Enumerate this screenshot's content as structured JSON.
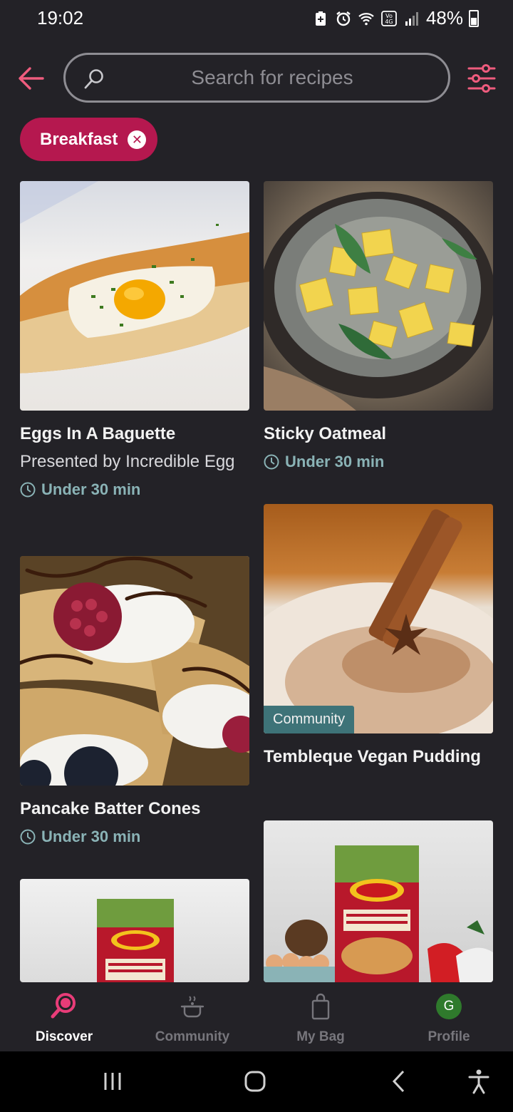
{
  "status_bar": {
    "time": "19:02",
    "battery": "48%",
    "icons": [
      "battery-saver-icon",
      "alarm-icon",
      "wifi-icon",
      "volte-4g-icon",
      "signal-icon",
      "battery-icon"
    ]
  },
  "header": {
    "back_icon": "arrow-left-icon",
    "search_placeholder": "Search for recipes",
    "filter_icon": "sliders-icon"
  },
  "filter_chip": {
    "label": "Breakfast",
    "close_glyph": "✕"
  },
  "recipes": [
    {
      "title": "Eggs In A Baguette",
      "subtitle": "Presented by Incredible Egg",
      "time": "Under 30 min"
    },
    {
      "title": "Sticky Oatmeal",
      "time": "Under 30 min"
    },
    {
      "title": "Tembleque Vegan Pudding",
      "badge": "Community"
    },
    {
      "title": "Pancake Batter Cones",
      "time": "Under 30 min"
    }
  ],
  "bottom_nav": {
    "items": [
      {
        "label": "Discover",
        "icon": "discover-icon",
        "active": true
      },
      {
        "label": "Community",
        "icon": "cooking-pot-icon",
        "active": false
      },
      {
        "label": "My Bag",
        "icon": "bag-icon",
        "active": false
      },
      {
        "label": "Profile",
        "icon": "avatar",
        "avatar_initial": "G",
        "active": false
      }
    ]
  },
  "colors": {
    "background": "#232227",
    "accent": "#b5184f",
    "accent_icon": "#e83c78",
    "time_text": "#8ab3b6",
    "community_badge": "#3e7378"
  }
}
